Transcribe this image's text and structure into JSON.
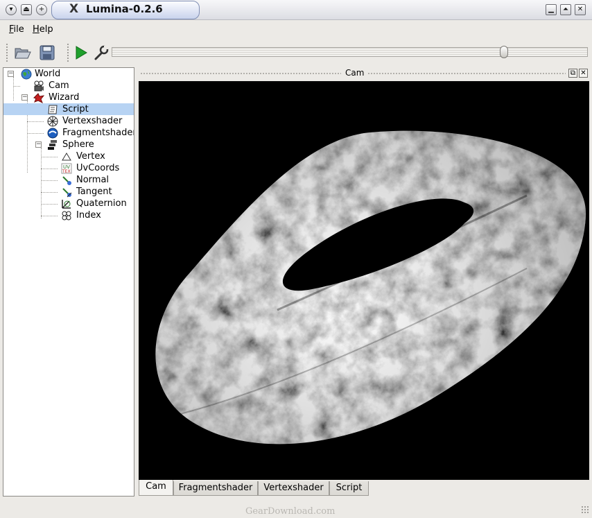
{
  "window": {
    "title": "Lumina-0.2.6",
    "title_glyph": "X",
    "left_buttons": [
      "menu-icon",
      "shade-icon",
      "sticky-icon"
    ],
    "right_buttons": [
      "minimize-icon",
      "maximize-icon",
      "close-icon"
    ]
  },
  "menu": [
    {
      "underline": "F",
      "rest": "ile"
    },
    {
      "underline": "H",
      "rest": "elp"
    }
  ],
  "toolbar": {
    "tools": [
      "open-folder-icon",
      "save-disk-icon",
      "play-icon",
      "wrench-icon"
    ],
    "slider_value_fraction": 0.83
  },
  "tree": {
    "items": [
      {
        "label": "World",
        "icon": "globe-icon",
        "selected": false
      },
      {
        "label": "Cam",
        "icon": "camera-icon",
        "selected": false
      },
      {
        "label": "Wizard",
        "icon": "wizard-icon",
        "selected": false
      },
      {
        "label": "Script",
        "icon": "script-icon",
        "selected": true
      },
      {
        "label": "Vertexshader",
        "icon": "vertexshader-icon",
        "selected": false
      },
      {
        "label": "Fragmentshader",
        "icon": "fragmentshader-icon",
        "selected": false
      },
      {
        "label": "Sphere",
        "icon": "sphere-icon",
        "selected": false
      },
      {
        "label": "Vertex",
        "icon": "vertex-icon",
        "selected": false
      },
      {
        "label": "UvCoords",
        "icon": "uvcoords-icon",
        "selected": false
      },
      {
        "label": "Normal",
        "icon": "normal-icon",
        "selected": false
      },
      {
        "label": "Tangent",
        "icon": "tangent-icon",
        "selected": false
      },
      {
        "label": "Quaternion",
        "icon": "quaternion-icon",
        "selected": false
      },
      {
        "label": "Index",
        "icon": "index-icon",
        "selected": false
      }
    ]
  },
  "dock": {
    "title": "Cam",
    "float_glyph": "⧉",
    "close_glyph": "✕"
  },
  "tabs": [
    {
      "label": "Cam",
      "active": true
    },
    {
      "label": "Fragmentshader",
      "active": false
    },
    {
      "label": "Vertexshader",
      "active": false
    },
    {
      "label": "Script",
      "active": false
    }
  ],
  "watermark": "GearDownload.com",
  "colors": {
    "accent_selection": "#b7d3f3",
    "viewport_bg": "#000000",
    "play_green": "#1fa02c"
  }
}
